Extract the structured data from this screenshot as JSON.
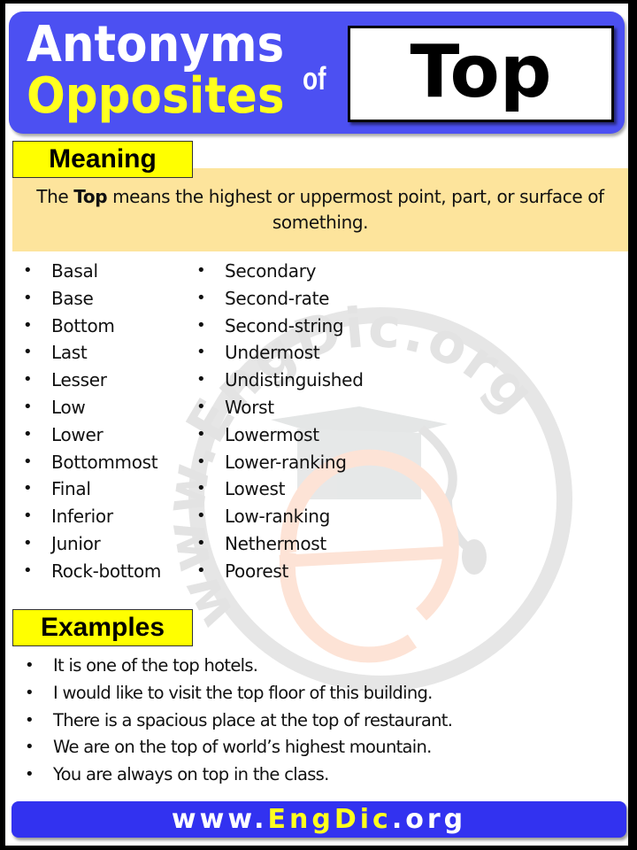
{
  "header": {
    "line1": "Antonyms",
    "line2": "Opposites",
    "connector": "of",
    "word": "Top",
    "colors": {
      "banner": "#4c50f2",
      "line1": "#ffffff",
      "line2": "#ffff1e"
    }
  },
  "meaning": {
    "label": "Meaning",
    "prefix": "The ",
    "term": "Top",
    "text": " means the highest or uppermost point, part, or surface of something.",
    "box_color": "#fde49c",
    "label_color": "#ffff00"
  },
  "antonyms": {
    "column1": [
      "Basal",
      "Base",
      "Bottom",
      "Last",
      "Lesser",
      "Low",
      "Lower",
      "Bottommost",
      "Final",
      "Inferior",
      "Junior",
      "Rock-bottom"
    ],
    "column2": [
      "Secondary",
      "Second-rate",
      "Second-string",
      "Undermost",
      "Undistinguished",
      "Worst",
      "Lowermost",
      "Lower-ranking",
      "Lowest",
      "Low-ranking",
      "Nethermost",
      "Poorest"
    ]
  },
  "examples": {
    "label": "Examples",
    "items": [
      "It is one of the top hotels.",
      "I would like to visit the top floor of this building.",
      "There is a spacious place at the top of restaurant.",
      "We are on the top of world’s highest mountain.",
      "You are always on top in the class."
    ]
  },
  "footer": {
    "part1": "www.",
    "part2": "EngDic",
    "part3": ".org",
    "color": "#3232f0"
  },
  "watermark": {
    "text": "www.EngDic.org",
    "icon": "graduation-cap-icon",
    "letter": "e"
  }
}
